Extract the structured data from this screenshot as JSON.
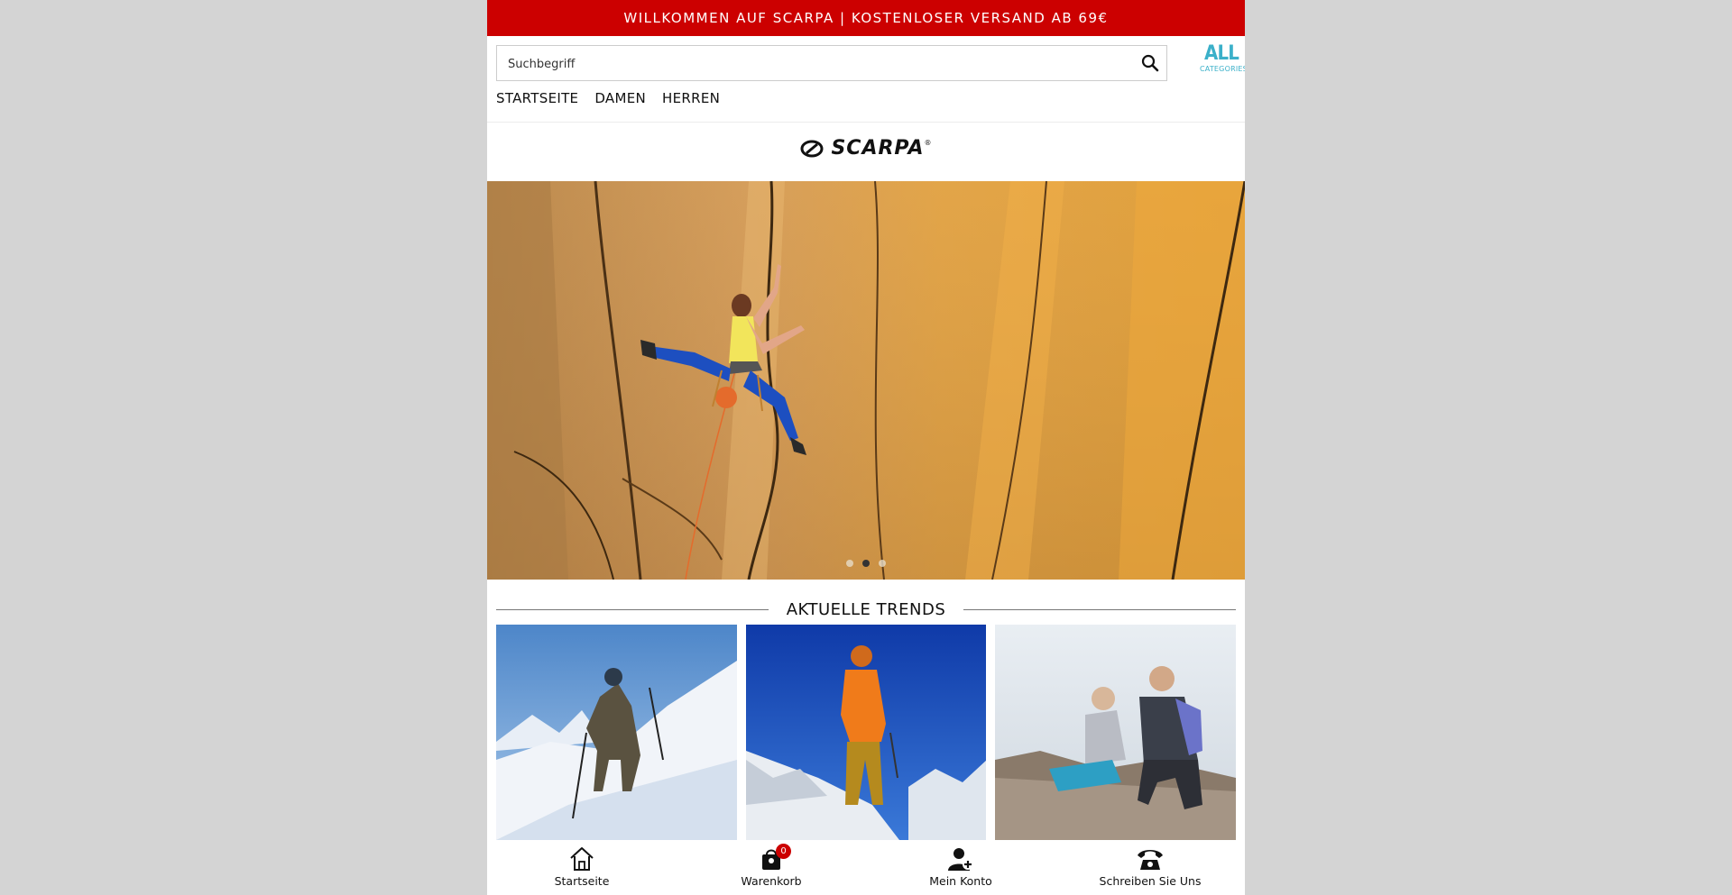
{
  "promo": {
    "text": "WILLKOMMEN AUF SCARPA | KOSTENLOSER VERSAND AB 69€"
  },
  "search": {
    "placeholder": "Suchbegriff",
    "icon": "search-icon"
  },
  "all_categories": {
    "big": "ALL",
    "small": "CATEGORIES",
    "color": "#3bb0c9"
  },
  "nav": {
    "items": [
      "STARTSEITE",
      "DAMEN",
      "HERREN"
    ]
  },
  "brand": {
    "name": "SCARPA",
    "mark": "®"
  },
  "hero": {
    "slides": 3,
    "active_slide": 2
  },
  "trends": {
    "title": "AKTUELLE TRENDS"
  },
  "bottom_nav": {
    "items": [
      {
        "label": "Startseite",
        "icon": "home-icon"
      },
      {
        "label": "Warenkorb",
        "icon": "cart-icon",
        "badge": "0"
      },
      {
        "label": "Mein Konto",
        "icon": "account-icon"
      },
      {
        "label": "Schreiben Sie Uns",
        "icon": "phone-icon"
      }
    ]
  },
  "colors": {
    "promo_bg": "#cc0000",
    "badge_bg": "#cc0000",
    "page_bg": "#d4d4d4"
  }
}
